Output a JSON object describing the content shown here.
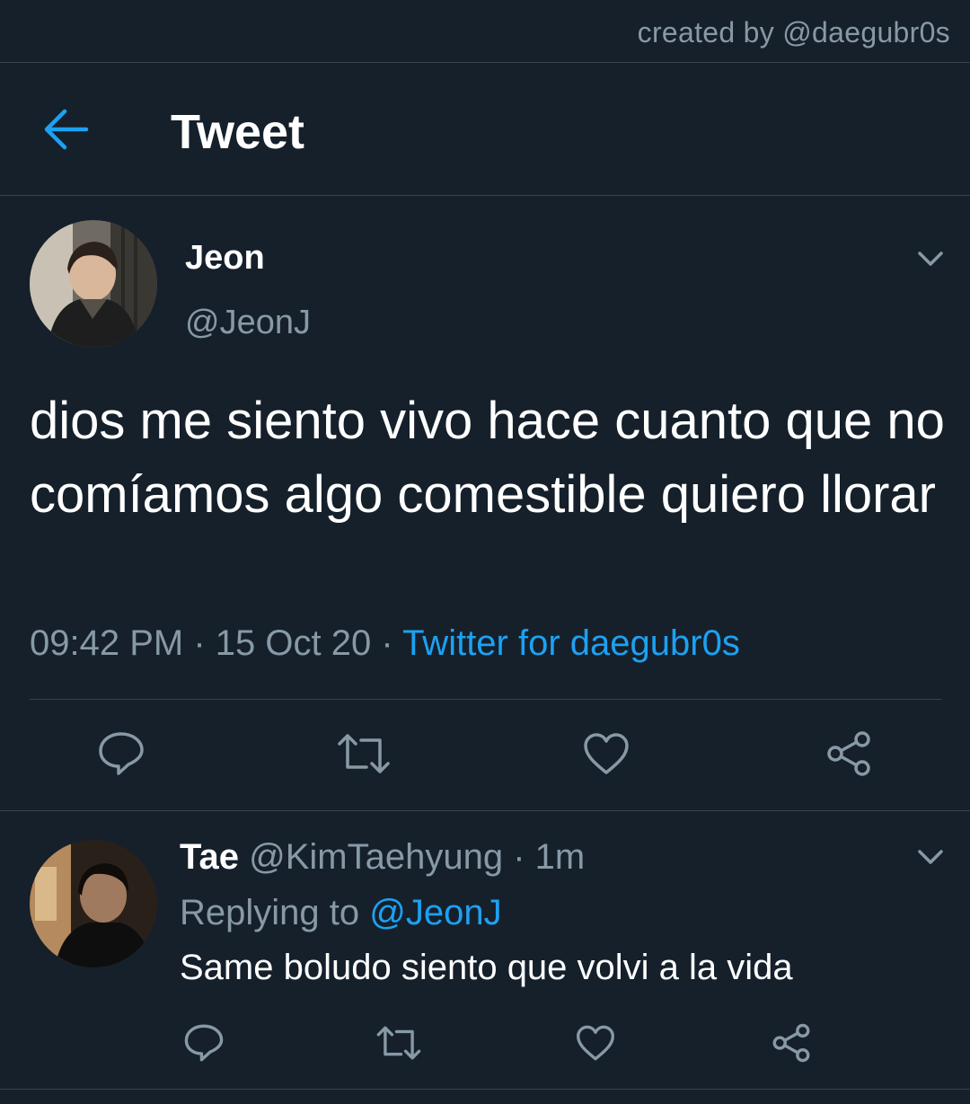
{
  "credit": "created by @daegubr0s",
  "header": {
    "title": "Tweet"
  },
  "tweet": {
    "author": {
      "name": "Jeon",
      "handle": "@JeonJ"
    },
    "text": "dios me siento vivo hace cuanto que no comíamos algo comestible quiero llorar",
    "time": "09:42 PM",
    "separator": "·",
    "date": "15 Oct 20",
    "source": "Twitter for daegubr0s"
  },
  "reply": {
    "author": {
      "name": "Tae",
      "handle": "@KimTaehyung"
    },
    "separator": "·",
    "age": "1m",
    "replying_prefix": "Replying to",
    "replying_to": "@JeonJ",
    "text": "Same boludo siento que volvi a la vida"
  },
  "icons": {
    "back": "arrow-left-icon",
    "menu": "chevron-down-icon",
    "reply": "comment-icon",
    "retweet": "retweet-icon",
    "like": "heart-icon",
    "share": "share-icon"
  },
  "colors": {
    "background": "#15202b",
    "accent": "#1da1f2",
    "secondary_text": "#8899a6",
    "divider": "#38444d"
  }
}
